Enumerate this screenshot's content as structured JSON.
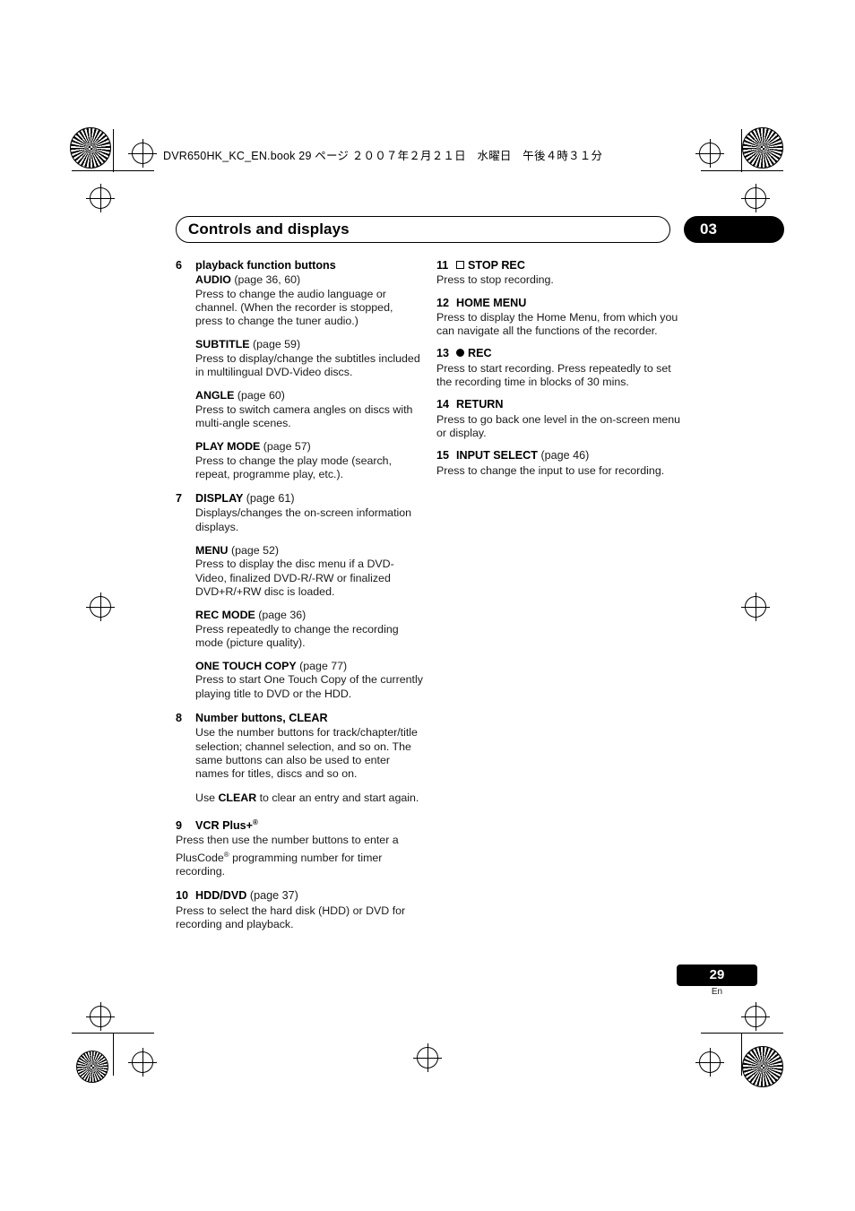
{
  "header": {
    "book_line": "DVR650HK_KC_EN.book  29 ページ  ２００７年２月２１日　水曜日　午後４時３１分",
    "chapter_title": "Controls and displays",
    "chapter_number": "03"
  },
  "footer": {
    "page_number": "29",
    "language": "En"
  },
  "left_column": [
    {
      "number": "6",
      "title": "playback function buttons",
      "subentries": [
        {
          "label": "AUDIO",
          "page_ref": "(page 36, 60)",
          "body": "Press to change the audio language or channel. (When the recorder is stopped, press to change the tuner audio.)"
        },
        {
          "label": "SUBTITLE",
          "page_ref": "(page 59)",
          "body": "Press  to display/change the subtitles included in multilingual DVD-Video discs."
        },
        {
          "label": "ANGLE",
          "page_ref": "(page 60)",
          "body": "Press to switch camera angles on discs with multi-angle scenes."
        },
        {
          "label": "PLAY MODE",
          "page_ref": "(page 57)",
          "body": "Press to change the play mode (search, repeat, programme play, etc.)."
        }
      ]
    },
    {
      "number": "7",
      "title": "DISPLAY",
      "title_page_ref": "(page 61)",
      "body": "Displays/changes the on-screen information displays.",
      "subentries": [
        {
          "label": "MENU",
          "page_ref": "(page 52)",
          "body": "Press to display the disc menu if a DVD-Video, finalized DVD-R/-RW or finalized DVD+R/+RW disc is loaded."
        },
        {
          "label": "REC MODE",
          "page_ref": "(page 36)",
          "body": "Press repeatedly to change the recording mode (picture quality)."
        },
        {
          "label": "ONE TOUCH COPY",
          "page_ref": "(page 77)",
          "body": "Press to start One Touch Copy of the currently playing title to DVD or the HDD."
        }
      ]
    },
    {
      "number": "8",
      "title": "Number buttons, CLEAR",
      "body": "Use the number buttons for track/chapter/title selection; channel selection, and so on. The same buttons can also be used to enter names for titles, discs and so on.",
      "body2_pre": "Use ",
      "body2_bold": "CLEAR",
      "body2_post": " to clear an entry and start again."
    },
    {
      "number": "9",
      "title": "VCR Plus+",
      "title_sup": "®",
      "body_pre": "Press then use the number buttons to enter a PlusCode",
      "body_sup": "®",
      "body_post": " programming number for timer recording."
    },
    {
      "number": "10",
      "title": "HDD/DVD",
      "title_page_ref": "(page 37)",
      "body": "Press to select the hard disk (HDD) or DVD for recording and playback."
    }
  ],
  "right_column": [
    {
      "number": "11",
      "icon": "stop-square-icon",
      "title": "STOP REC",
      "body": "Press to stop recording."
    },
    {
      "number": "12",
      "title": "HOME MENU",
      "body": "Press to display the Home Menu, from which you can navigate all the functions of the recorder."
    },
    {
      "number": "13",
      "icon": "record-dot-icon",
      "title": "REC",
      "body": "Press to start recording. Press repeatedly to set the recording time in blocks of 30 mins."
    },
    {
      "number": "14",
      "title": "RETURN",
      "body": "Press to go back one level in the on-screen menu or display."
    },
    {
      "number": "15",
      "title": "INPUT SELECT",
      "title_page_ref": "(page 46)",
      "body": "Press to change the input to use for recording."
    }
  ]
}
